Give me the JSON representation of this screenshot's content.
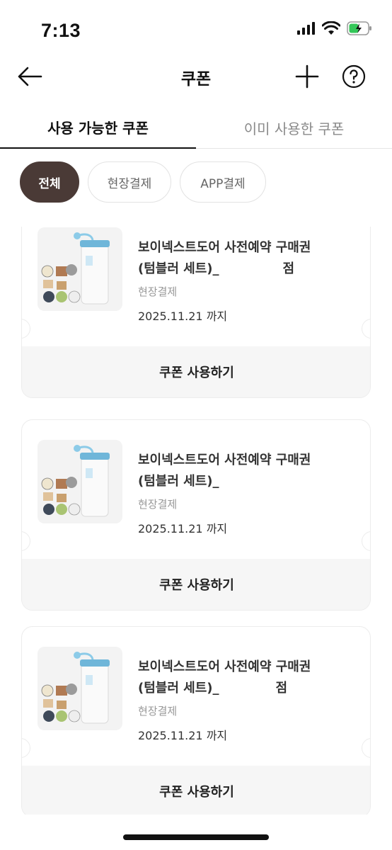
{
  "status_bar": {
    "time": "7:13"
  },
  "nav": {
    "title": "쿠폰"
  },
  "tabs": [
    {
      "label": "사용 가능한 쿠폰",
      "active": true
    },
    {
      "label": "이미 사용한 쿠폰",
      "active": false
    }
  ],
  "filters": [
    {
      "label": "전체",
      "selected": true
    },
    {
      "label": "현장결제",
      "selected": false
    },
    {
      "label": "APP결제",
      "selected": false
    }
  ],
  "coupons": [
    {
      "title_line1": "보이넥스트도어 사전예약 구매권",
      "title_line2": "(텀블러 세트)_",
      "title_line2_suffix": "점",
      "type": "현장결제",
      "expiry": "2025.11.21 까지",
      "button": "쿠폰 사용하기"
    },
    {
      "title_line1": "보이넥스트도어 사전예약 구매권",
      "title_line2": "(텀블러 세트)_",
      "title_line2_suffix": "",
      "type": "현장결제",
      "expiry": "2025.11.21 까지",
      "button": "쿠폰 사용하기"
    },
    {
      "title_line1": "보이넥스트도어 사전예약 구매권",
      "title_line2": "(텀블러 세트)_",
      "title_line2_suffix": "점",
      "type": "현장결제",
      "expiry": "2025.11.21 까지",
      "button": "쿠폰 사용하기"
    }
  ],
  "colors": {
    "accent_chip": "#4a3a36",
    "battery_fill": "#34c759"
  }
}
